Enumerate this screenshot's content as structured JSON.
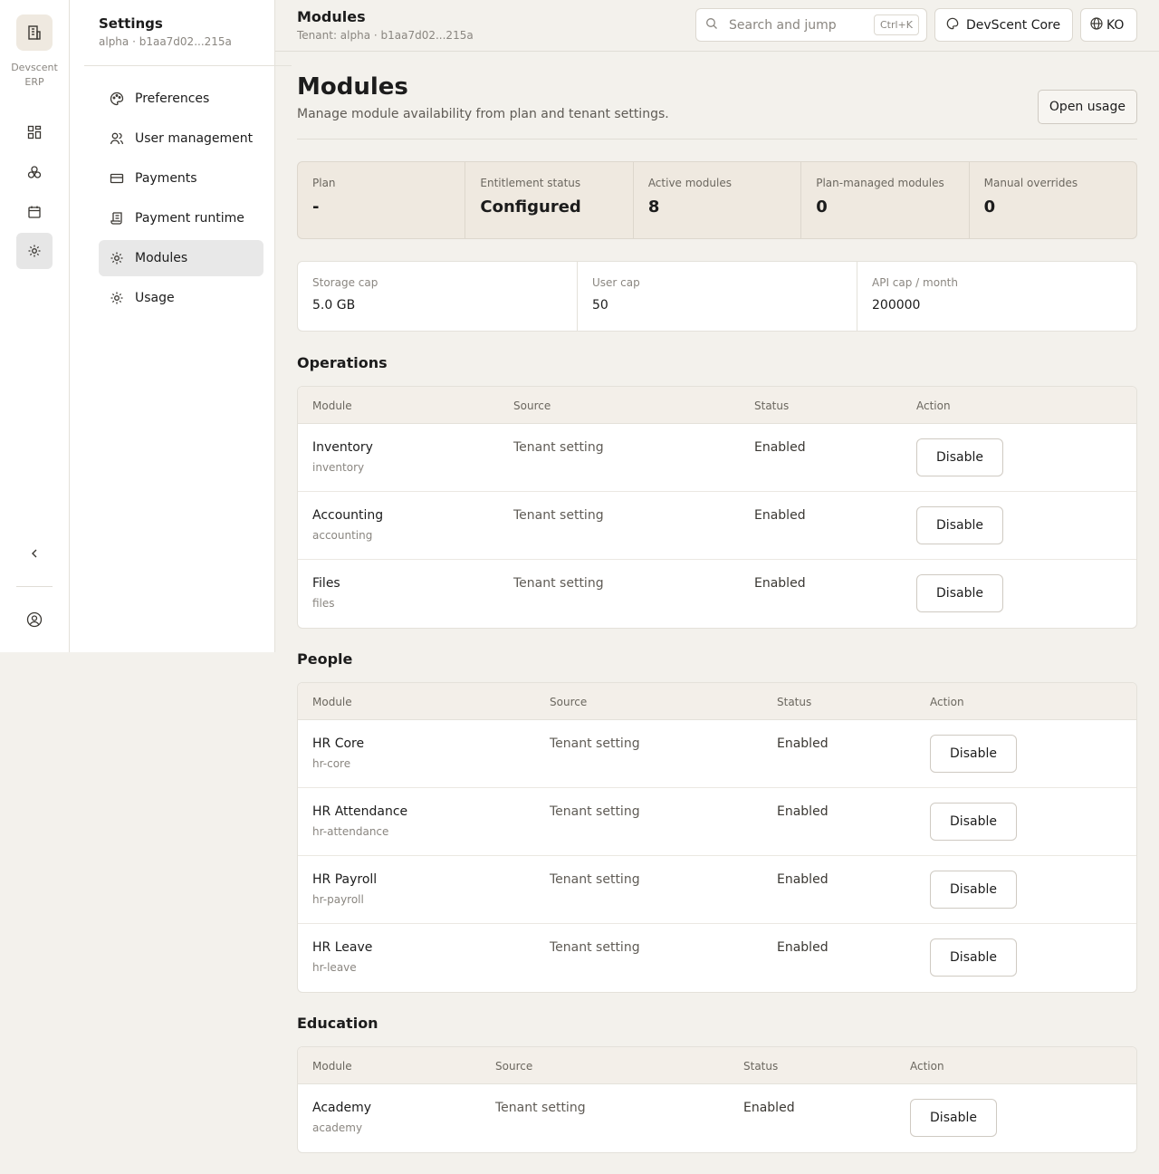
{
  "rail": {
    "brand_line1": "Devscent",
    "brand_line2": "ERP",
    "icons": [
      "building-icon",
      "grid-icon",
      "modules-icon",
      "calendar-icon",
      "gear-icon",
      "chevron-left-icon",
      "user-circle-icon"
    ]
  },
  "sidebar": {
    "title": "Settings",
    "subtitle": "alpha · b1aa7d02...215a",
    "items": [
      {
        "label": "Preferences",
        "icon": "palette-icon"
      },
      {
        "label": "User management",
        "icon": "users-icon"
      },
      {
        "label": "Payments",
        "icon": "credit-card-icon"
      },
      {
        "label": "Payment runtime",
        "icon": "receipt-icon"
      },
      {
        "label": "Modules",
        "icon": "gear-icon",
        "active": true
      },
      {
        "label": "Usage",
        "icon": "gear-icon"
      }
    ]
  },
  "topbar": {
    "title": "Modules",
    "subtitle": "Tenant: alpha · b1aa7d02...215a",
    "search_placeholder": "Search and jump",
    "search_shortcut": "Ctrl+K",
    "workspace_label": "DevScent Core",
    "language_label": "KO"
  },
  "page": {
    "title": "Modules",
    "description": "Manage module availability from plan and tenant settings.",
    "open_usage_label": "Open usage"
  },
  "stats": [
    {
      "label": "Plan",
      "value": "-"
    },
    {
      "label": "Entitlement status",
      "value": "Configured"
    },
    {
      "label": "Active modules",
      "value": "8"
    },
    {
      "label": "Plan-managed modules",
      "value": "0"
    },
    {
      "label": "Manual overrides",
      "value": "0"
    }
  ],
  "caps": [
    {
      "label": "Storage cap",
      "value": "5.0 GB"
    },
    {
      "label": "User cap",
      "value": "50"
    },
    {
      "label": "API cap / month",
      "value": "200000"
    }
  ],
  "table_headers": {
    "module": "Module",
    "source": "Source",
    "status": "Status",
    "action": "Action"
  },
  "sections": [
    {
      "title": "Operations",
      "rows": [
        {
          "name": "Inventory",
          "key": "inventory",
          "source": "Tenant setting",
          "status": "Enabled",
          "action": "Disable"
        },
        {
          "name": "Accounting",
          "key": "accounting",
          "source": "Tenant setting",
          "status": "Enabled",
          "action": "Disable"
        },
        {
          "name": "Files",
          "key": "files",
          "source": "Tenant setting",
          "status": "Enabled",
          "action": "Disable"
        }
      ]
    },
    {
      "title": "People",
      "rows": [
        {
          "name": "HR Core",
          "key": "hr-core",
          "source": "Tenant setting",
          "status": "Enabled",
          "action": "Disable"
        },
        {
          "name": "HR Attendance",
          "key": "hr-attendance",
          "source": "Tenant setting",
          "status": "Enabled",
          "action": "Disable"
        },
        {
          "name": "HR Payroll",
          "key": "hr-payroll",
          "source": "Tenant setting",
          "status": "Enabled",
          "action": "Disable"
        },
        {
          "name": "HR Leave",
          "key": "hr-leave",
          "source": "Tenant setting",
          "status": "Enabled",
          "action": "Disable"
        }
      ]
    },
    {
      "title": "Education",
      "rows": [
        {
          "name": "Academy",
          "key": "academy",
          "source": "Tenant setting",
          "status": "Enabled",
          "action": "Disable"
        }
      ]
    }
  ]
}
